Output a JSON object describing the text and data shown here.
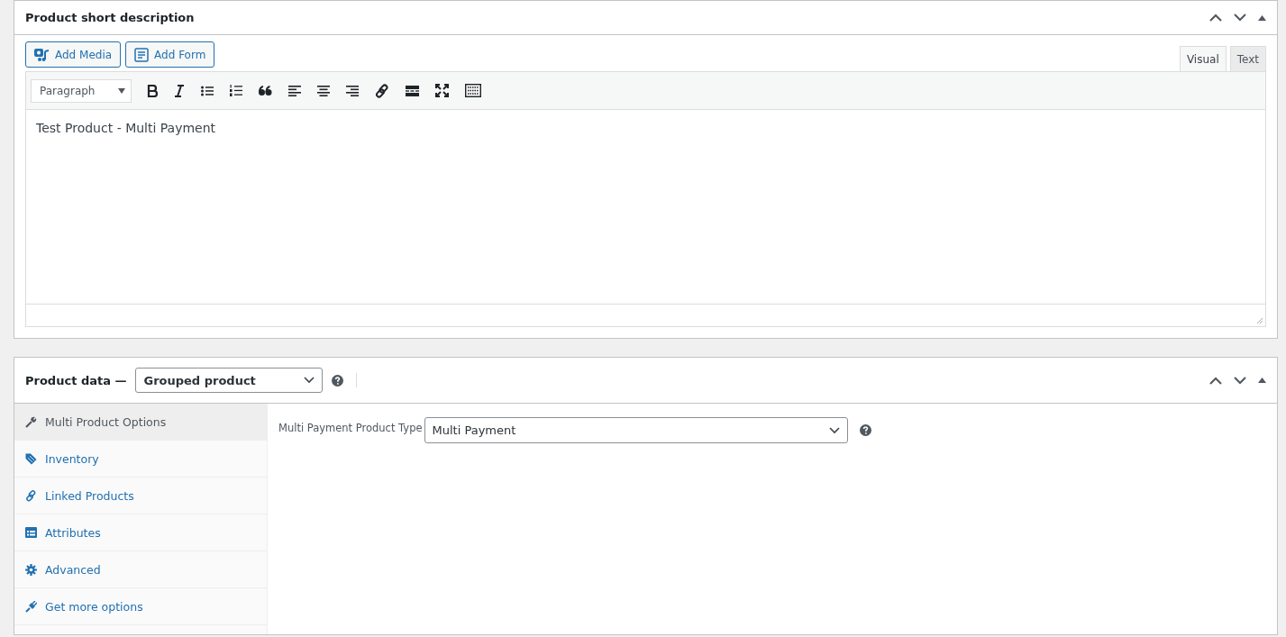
{
  "short_description": {
    "title": "Product short description",
    "media_buttons": [
      {
        "kind": "media",
        "label": "Add Media"
      },
      {
        "kind": "form",
        "label": "Add Form"
      }
    ],
    "editor_tabs": [
      {
        "label": "Visual",
        "selected": true
      },
      {
        "label": "Text",
        "selected": false
      }
    ],
    "format_select": "Paragraph",
    "toolbar": [
      {
        "kind": "bold"
      },
      {
        "kind": "italic"
      },
      {
        "kind": "bullets"
      },
      {
        "kind": "numbers"
      },
      {
        "kind": "quote"
      },
      {
        "kind": "align-left"
      },
      {
        "kind": "align-center"
      },
      {
        "kind": "align-right"
      },
      {
        "kind": "link"
      },
      {
        "kind": "more"
      },
      {
        "kind": "fullscreen"
      },
      {
        "kind": "toolbar"
      }
    ],
    "content": "Test Product - Multi Payment"
  },
  "product_data": {
    "title": "Product data —",
    "type_select": "Grouped product",
    "tabs": [
      {
        "kind": "wrench",
        "label": "Multi Product Options",
        "selected": true
      },
      {
        "kind": "tag",
        "label": "Inventory",
        "selected": false
      },
      {
        "kind": "link",
        "label": "Linked Products",
        "selected": false
      },
      {
        "kind": "list",
        "label": "Attributes",
        "selected": false
      },
      {
        "kind": "gear",
        "label": "Advanced",
        "selected": false
      },
      {
        "kind": "plug",
        "label": "Get more options",
        "selected": false
      }
    ],
    "field": {
      "label": "Multi Payment Product Type",
      "value": "Multi Payment"
    }
  }
}
